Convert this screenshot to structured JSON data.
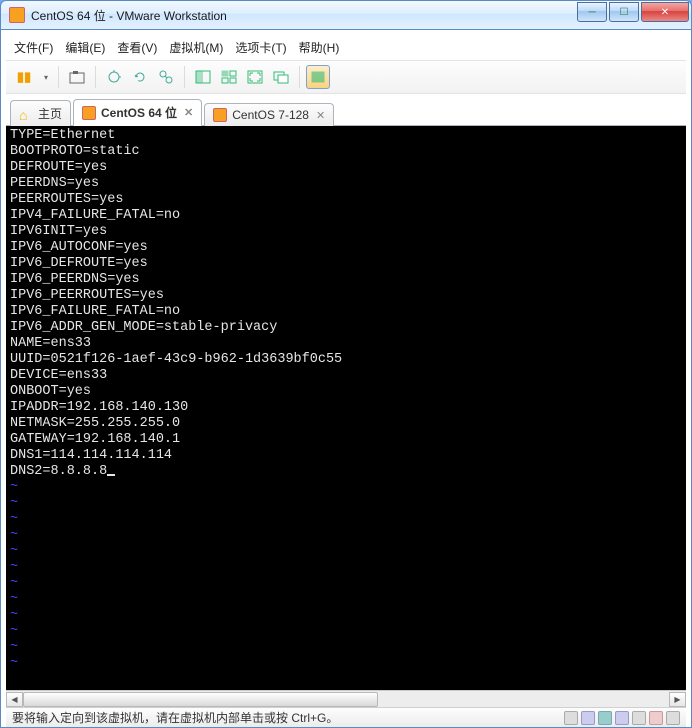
{
  "window": {
    "title": "CentOS 64 位 - VMware Workstation",
    "min_label": "─",
    "max_label": "☐",
    "close_label": "✕"
  },
  "menu": {
    "file": "文件(F)",
    "edit": "编辑(E)",
    "view": "查看(V)",
    "vm": "虚拟机(M)",
    "tabs": "选项卡(T)",
    "help": "帮助(H)"
  },
  "tabs": [
    {
      "label": "主页",
      "icon": "home",
      "closable": false
    },
    {
      "label": "CentOS 64 位",
      "icon": "cent",
      "closable": true,
      "active": true
    },
    {
      "label": "CentOS 7-128",
      "icon": "cent",
      "closable": true
    }
  ],
  "terminal": {
    "lines": [
      "TYPE=Ethernet",
      "BOOTPROTO=static",
      "DEFROUTE=yes",
      "PEERDNS=yes",
      "PEERROUTES=yes",
      "IPV4_FAILURE_FATAL=no",
      "IPV6INIT=yes",
      "IPV6_AUTOCONF=yes",
      "IPV6_DEFROUTE=yes",
      "IPV6_PEERDNS=yes",
      "IPV6_PEERROUTES=yes",
      "IPV6_FAILURE_FATAL=no",
      "IPV6_ADDR_GEN_MODE=stable-privacy",
      "NAME=ens33",
      "UUID=0521f126-1aef-43c9-b962-1d3639bf0c55",
      "DEVICE=ens33",
      "ONBOOT=yes",
      "IPADDR=192.168.140.130",
      "NETMASK=255.255.255.0",
      "GATEWAY=192.168.140.1",
      "DNS1=114.114.114.114",
      "DNS2=8.8.8.8"
    ],
    "tilde_count": 12
  },
  "status": {
    "text": "要将输入定向到该虚拟机，请在虚拟机内部单击或按 Ctrl+G。"
  },
  "scrollbar": {
    "left": "◀",
    "right": "▶"
  }
}
